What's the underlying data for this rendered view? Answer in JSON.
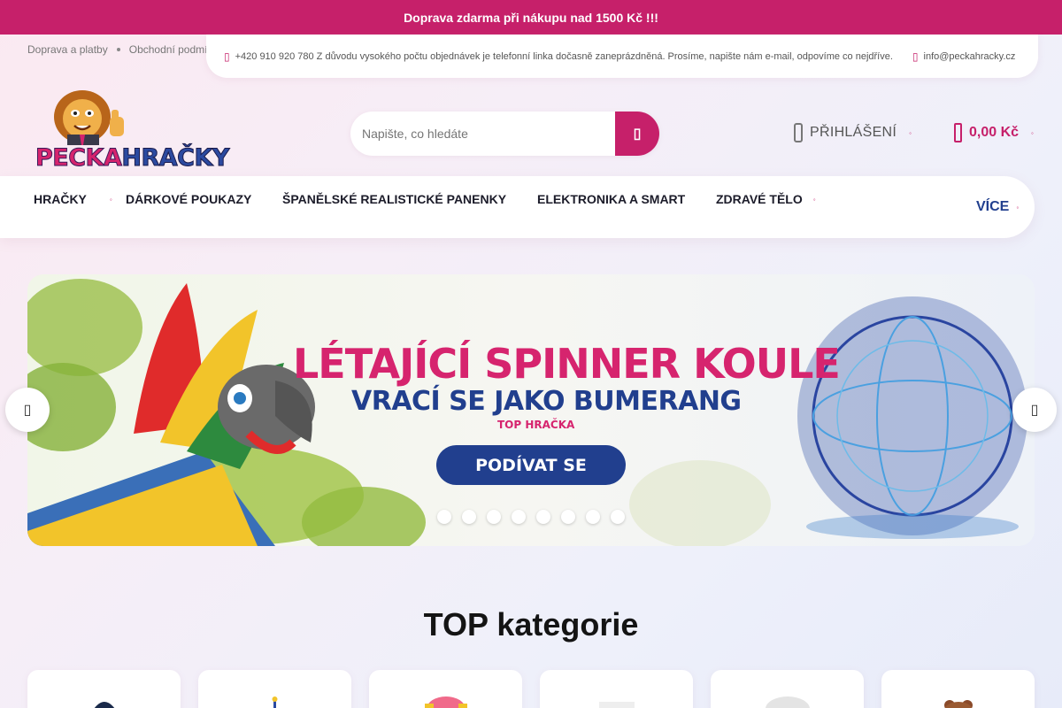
{
  "announcement": "Doprava zdarma při nákupu nad 1500 Kč !!!",
  "util_links": [
    "Doprava a platby",
    "Obchodní podmí"
  ],
  "contact": {
    "phone_text": "+420 910 920 780 Z důvodu vysokého počtu objednávek je telefonní linka dočasně zaneprázdněná. Prosíme, napište nám e-mail, odpovíme co nejdříve.",
    "email": "info@peckahracky.cz"
  },
  "logo": {
    "part1": "PECKA",
    "part2": "HRAČKY"
  },
  "search": {
    "placeholder": "Napište, co hledáte"
  },
  "account": {
    "login_label": "PŘIHLÁŠENÍ"
  },
  "cart": {
    "total": "0,00 Kč"
  },
  "nav": {
    "items": [
      "HRAČKY",
      "DÁRKOVÉ POUKAZY",
      "ŠPANĚLSKÉ REALISTICKÉ PANENKY",
      "ELEKTRONIKA A SMART",
      "ZDRAVÉ TĚLO"
    ],
    "more": "VÍCE"
  },
  "banner": {
    "title": "LÉTAJÍCÍ SPINNER KOULE",
    "subtitle": "VRACÍ SE JAKO BUMERANG",
    "tag": "TOP HRAČKA",
    "cta": "PODÍVAT SE",
    "slide_count": 8
  },
  "section": {
    "title": "TOP kategorie"
  },
  "colors": {
    "brand": "#c6206a",
    "accent_blue": "#213f8e"
  }
}
